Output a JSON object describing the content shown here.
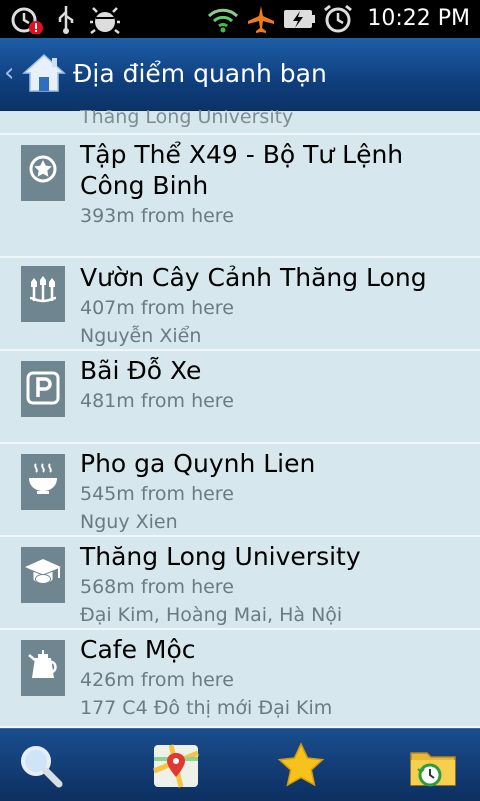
{
  "status": {
    "time": "10:22 PM",
    "icons": [
      "alarm-alert-icon",
      "usb-icon",
      "debug-icon",
      "wifi-icon",
      "airplane-icon",
      "battery-charging-icon",
      "alarm-icon"
    ]
  },
  "header": {
    "title": "Địa điểm quanh bạn",
    "back_icon": "chevron-left-icon",
    "home_icon": "home-icon"
  },
  "list": {
    "partial_item": "Thăng Long University",
    "items": [
      {
        "name": "Tập Thể X49 - Bộ Tư Lệnh Công Binh",
        "distance": "393m from here",
        "address": "",
        "icon": "star-badge-icon"
      },
      {
        "name": "Vườn Cây Cảnh Thăng Long",
        "distance": "407m from here",
        "address": "Nguyễn Xiển",
        "icon": "flowers-icon"
      },
      {
        "name": "Bãi Đỗ Xe",
        "distance": "481m from here",
        "address": "",
        "icon": "parking-icon"
      },
      {
        "name": "Pho ga Quynh Lien",
        "distance": "545m from here",
        "address": "Nguy Xien",
        "icon": "food-bowl-icon"
      },
      {
        "name": "Thăng Long University",
        "distance": "568m from here",
        "address": "Đại Kim, Hoàng Mai, Hà Nội",
        "icon": "graduation-cap-icon"
      },
      {
        "name": "Cafe Mộc",
        "distance": "426m from here",
        "address": "177 C4 Đô thị mới Đại Kim",
        "icon": "coffee-pot-icon"
      }
    ]
  },
  "bottom_nav": [
    "search-icon",
    "map-icon",
    "star-icon",
    "history-folder-icon"
  ],
  "colors": {
    "header": "#0f3f7d",
    "list_bg": "#d6e8ee",
    "icon_bg": "#6f8590"
  }
}
